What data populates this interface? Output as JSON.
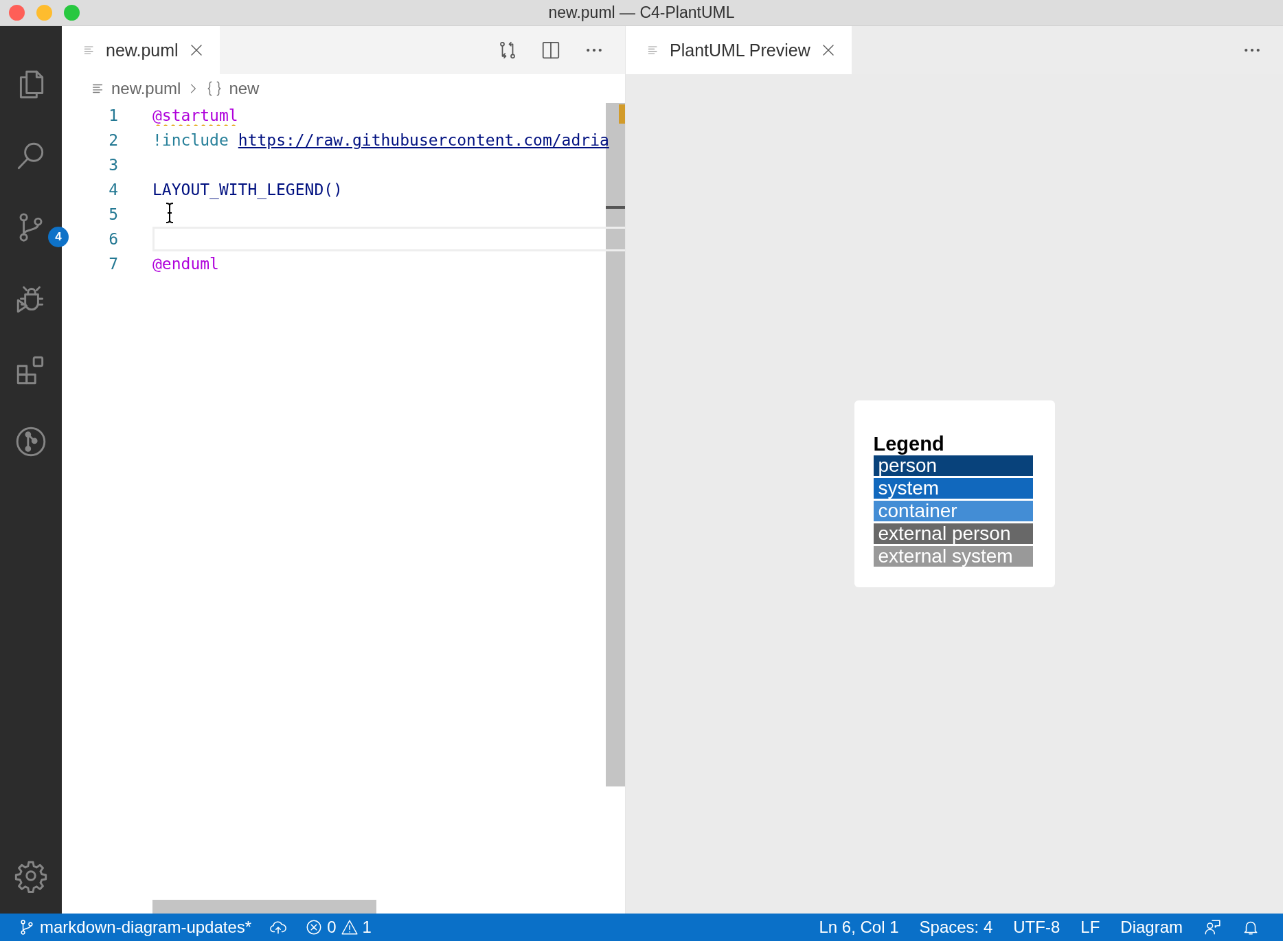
{
  "window": {
    "title": "new.puml — C4-PlantUML"
  },
  "activity_bar": {
    "source_control_badge": "4"
  },
  "editor": {
    "tabs": [
      {
        "label": "new.puml",
        "selected": true
      }
    ],
    "breadcrumb": [
      {
        "text": "new.puml",
        "kind": "file"
      },
      {
        "text": "new",
        "kind": "symbol"
      }
    ],
    "lines": [
      {
        "number": "1",
        "tokens": [
          {
            "text": "@startuml",
            "kind": "directive"
          }
        ],
        "warning": true,
        "current": false
      },
      {
        "number": "2",
        "tokens": [
          {
            "text": "!include",
            "kind": "keyword"
          },
          {
            "text": "https://raw.githubusercontent.com/adria",
            "kind": "url"
          }
        ],
        "warning": false,
        "current": false
      },
      {
        "number": "3",
        "current": false
      },
      {
        "number": "4",
        "tokens": [
          {
            "text": "LAYOUT_WITH_LEGEND()",
            "kind": "plain"
          }
        ],
        "warning": false,
        "current": false
      },
      {
        "number": "5",
        "current": false
      },
      {
        "number": "6",
        "current": true
      },
      {
        "number": "7",
        "tokens": [
          {
            "text": "@enduml",
            "kind": "directive"
          }
        ],
        "warning": false,
        "current": false
      }
    ]
  },
  "preview": {
    "tabs": [
      {
        "label": "PlantUML Preview",
        "selected": true
      }
    ],
    "legend": {
      "title": "Legend",
      "items": [
        {
          "label": "person",
          "color": "#08427b"
        },
        {
          "label": "system",
          "color": "#1168bd"
        },
        {
          "label": "container",
          "color": "#438dd5"
        },
        {
          "label": "external person",
          "color": "#686868"
        },
        {
          "label": "external system",
          "color": "#999999"
        }
      ]
    }
  },
  "status_bar": {
    "items": [
      {
        "kind": "branch",
        "text": "markdown-diagram-updates*"
      },
      {
        "kind": "sync"
      },
      {
        "kind": "errors",
        "text": "0"
      },
      {
        "kind": "warnings",
        "text": "1"
      },
      {
        "kind": "text",
        "text": "Ln 6, Col 1"
      },
      {
        "kind": "text",
        "text": "Spaces: 4"
      },
      {
        "kind": "text",
        "text": "UTF-8"
      },
      {
        "kind": "text",
        "text": "LF"
      },
      {
        "kind": "text",
        "text": "Diagram"
      },
      {
        "kind": "feedback"
      },
      {
        "kind": "bell"
      }
    ]
  }
}
